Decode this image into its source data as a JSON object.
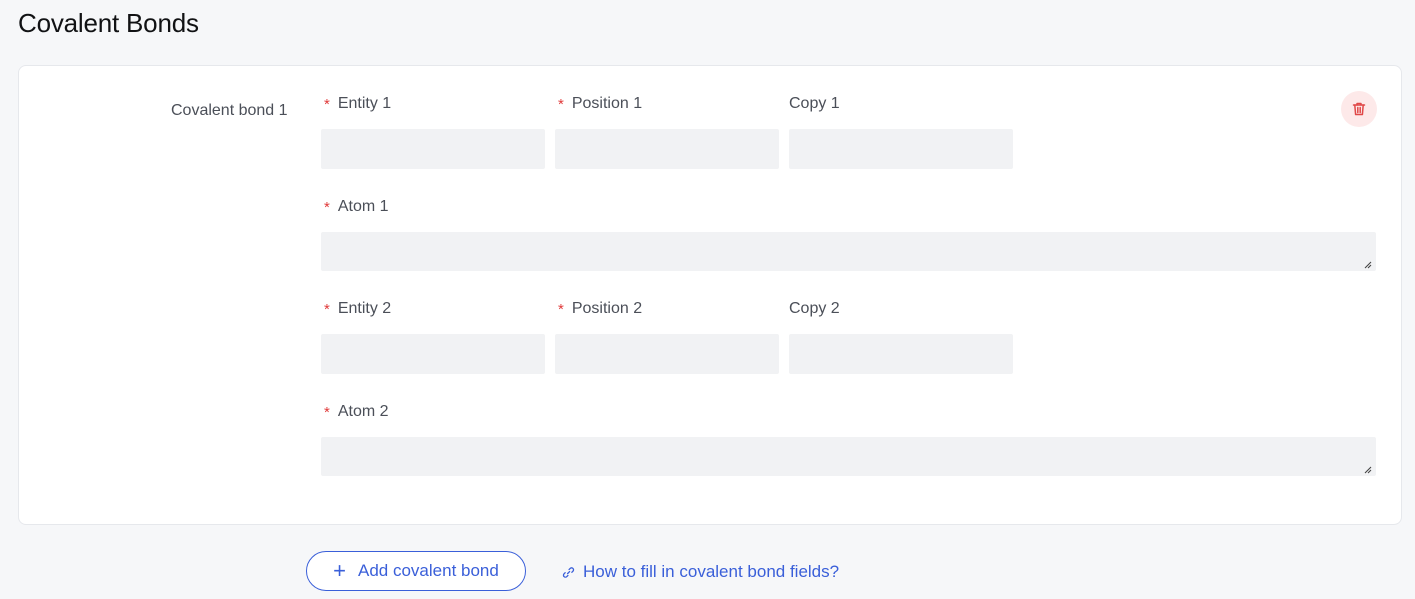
{
  "page": {
    "title": "Covalent Bonds"
  },
  "bond": {
    "label": "Covalent bond 1",
    "fields": {
      "entity1": {
        "label": "Entity 1",
        "required": true,
        "value": ""
      },
      "position1": {
        "label": "Position 1",
        "required": true,
        "value": ""
      },
      "copy1": {
        "label": "Copy 1",
        "required": false,
        "value": ""
      },
      "atom1": {
        "label": "Atom 1",
        "required": true,
        "value": ""
      },
      "entity2": {
        "label": "Entity 2",
        "required": true,
        "value": ""
      },
      "position2": {
        "label": "Position 2",
        "required": true,
        "value": ""
      },
      "copy2": {
        "label": "Copy 2",
        "required": false,
        "value": ""
      },
      "atom2": {
        "label": "Atom 2",
        "required": true,
        "value": ""
      }
    },
    "required_marker": "*",
    "delete_icon": "trash-icon"
  },
  "actions": {
    "add_label": "Add covalent bond",
    "add_icon": "plus-icon",
    "help_label": "How to fill in covalent bond fields?",
    "help_icon": "link-icon"
  },
  "colors": {
    "accent": "#3a5fd9",
    "required": "#e03a3a",
    "delete_bg": "#fde9e9",
    "delete_icon": "#e04848",
    "input_bg": "#f1f2f4"
  }
}
